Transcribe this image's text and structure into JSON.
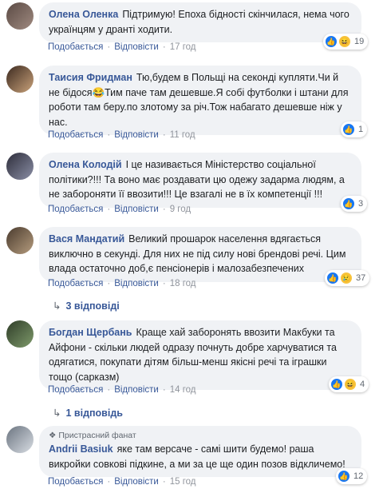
{
  "comments": [
    {
      "name": "Олена Оленка",
      "text": "Підтримую! Епоха бідності скінчилася, нема чого українцям у дранті ходити.",
      "like_label": "Подобається",
      "reply_label": "Відповісти",
      "time": "17 год",
      "reactions": [
        "like",
        "haha"
      ],
      "reaction_count": "19"
    },
    {
      "name": "Таисия Фридман",
      "text": "Тю,будем в Польщі на секонді купляти.Чи й не бідося😂Тим паче там дешевше.Я собі футболки і штани для роботи там беру.по злотому за річ.Тож набагато дешевше ніж у нас.",
      "like_label": "Подобається",
      "reply_label": "Відповісти",
      "time": "11 год",
      "reactions": [
        "like"
      ],
      "reaction_count": "1"
    },
    {
      "name": "Олена Колодій",
      "text": "І це називається Міністерство соціальної політики?!!! Та воно має роздавати цю одежу задарма людям, а не забороняти її ввозити!!! Це взагалі не в їх компетенції !!!",
      "like_label": "Подобається",
      "reply_label": "Відповісти",
      "time": "9 год",
      "reactions": [
        "like"
      ],
      "reaction_count": "3"
    },
    {
      "name": "Вася Мандатий",
      "text": "Великий прошарок населення вдягається виключно в секунді. Для них не під силу нові брендові речі. Цим влада остаточно доб,є пенсіонерів і малозабезпечених",
      "like_label": "Подобається",
      "reply_label": "Відповісти",
      "time": "18 год",
      "reactions": [
        "like",
        "sad"
      ],
      "reaction_count": "37",
      "replies_label": "3 відповіді"
    },
    {
      "name": "Богдан Щербань",
      "text": "Краще хай заборонять ввозити Макбуки та Айфони - скільки людей одразу почнуть добре харчуватися та одягатися, покупати дітям більш-менш якісні речі та іграшки тощо (сарказм)",
      "like_label": "Подобається",
      "reply_label": "Відповісти",
      "time": "14 год",
      "reactions": [
        "like",
        "haha"
      ],
      "reaction_count": "4",
      "replies_label": "1 відповідь"
    },
    {
      "badge": "Пристрасний фанат",
      "name": "Andrii Basiuk",
      "text": "яке там версаче - самі шити будемо! раша викройки совкові підкине, а ми за це ще один позов відкличемо!",
      "like_label": "Подобається",
      "reply_label": "Відповісти",
      "time": "15 год",
      "reactions": [
        "like"
      ],
      "reaction_count": "12"
    }
  ],
  "icons": {
    "like": "like-icon",
    "haha": "haha-icon",
    "sad": "sad-icon",
    "reply_arrow": "reply-arrow-icon",
    "badge": "fan-badge-icon"
  },
  "colors": {
    "name": "#385898",
    "bubble": "#f0f2f5",
    "like": "#1877f2",
    "emoji": "#f7c33b"
  }
}
